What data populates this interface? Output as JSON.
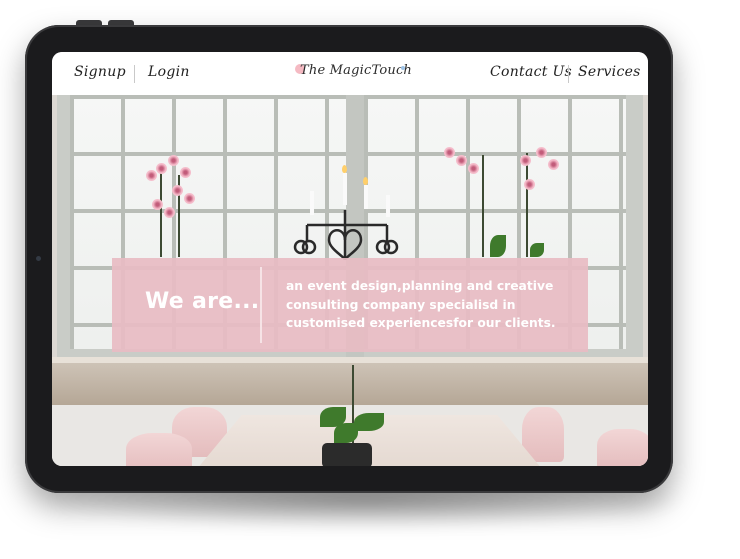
{
  "nav": {
    "signup_label": "Signup",
    "login_label": "Login",
    "brand": "The MagicTouch",
    "contact_label": "Contact Us",
    "services_label": "Services"
  },
  "hero": {
    "headline": "We are...",
    "tagline_lines": [
      "an event design,planning and creative",
      "consulting company specialisd in",
      "customised experiencesfor our clients."
    ],
    "banner_color": "#e8bcc3"
  },
  "device": {
    "frame_color": "#1b1b1d"
  }
}
